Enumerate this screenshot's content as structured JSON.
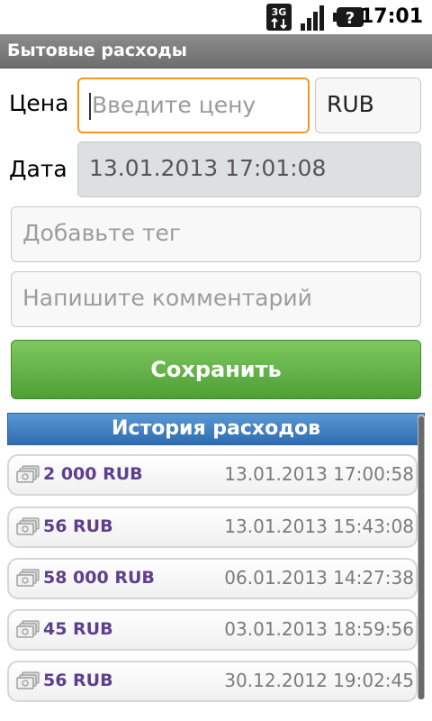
{
  "status_bar": {
    "time": "17:01",
    "network_label": "3G",
    "battery_label": "?",
    "icons": [
      "3g-data-icon",
      "signal-icon",
      "battery-unknown-icon"
    ]
  },
  "title_bar": {
    "title": "Бытовые расходы"
  },
  "form": {
    "price_label": "Цена",
    "price_placeholder": "Введите цену",
    "currency_value": "RUB",
    "date_label": "Дата",
    "date_value": "13.01.2013 17:01:08",
    "tag_placeholder": "Добавьте тег",
    "comment_placeholder": "Напишите комментарий",
    "save_label": "Сохранить"
  },
  "history": {
    "title": "История расходов",
    "items": [
      {
        "amount": "2 000 RUB",
        "date": "13.01.2013 17:00:58"
      },
      {
        "amount": "56 RUB",
        "date": "13.01.2013 15:43:08"
      },
      {
        "amount": "58 000 RUB",
        "date": "06.01.2013 14:27:38"
      },
      {
        "amount": "45 RUB",
        "date": "03.01.2013 18:59:56"
      },
      {
        "amount": "56 RUB",
        "date": "30.12.2012 19:02:45"
      }
    ]
  },
  "colors": {
    "accent_focus": "#f29a1b",
    "save_button": "#5fae42",
    "history_header": "#3d7cc0",
    "amount_text": "#5e3f8f"
  }
}
